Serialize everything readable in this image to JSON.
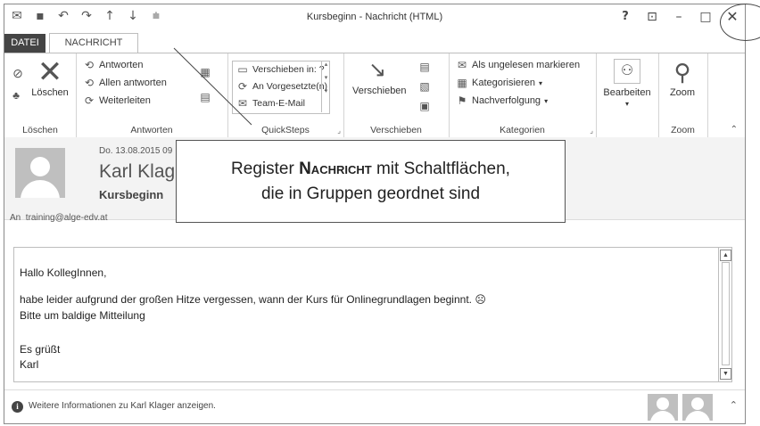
{
  "window": {
    "title": "Kursbeginn - Nachricht (HTML)",
    "qat_icons": [
      "mail-icon",
      "save-icon",
      "undo-icon",
      "redo-icon",
      "up-arrow-icon",
      "down-arrow-icon",
      "qat-customize-icon"
    ],
    "controls": {
      "help": "?",
      "ribbon_display": "⊡",
      "minimize": "–",
      "maximize": "□",
      "close": "✕"
    }
  },
  "tabs": {
    "datei": "DATEI",
    "nachricht": "NACHRICHT"
  },
  "ribbon": {
    "loeschen": {
      "label": "Löschen",
      "delete": "Löschen"
    },
    "antworten": {
      "label": "Antworten",
      "reply": "Antworten",
      "reply_all": "Allen antworten",
      "forward": "Weiterleiten"
    },
    "quicksteps": {
      "label": "QuickSteps",
      "items": [
        "Verschieben in: ?",
        "An Vorgesetzte(n)",
        "Team-E-Mail"
      ]
    },
    "verschieben": {
      "label": "Verschieben",
      "move": "Verschieben"
    },
    "kategorien": {
      "label": "Kategorien",
      "unread": "Als ungelesen markieren",
      "categorize": "Kategorisieren",
      "followup": "Nachverfolgung"
    },
    "bearbeiten": {
      "edit": "Bearbeiten"
    },
    "zoom": {
      "label": "Zoom",
      "zoom": "Zoom"
    }
  },
  "header": {
    "date": "Do. 13.08.2015 09",
    "sender": "Karl Klage",
    "subject": "Kursbeginn",
    "recipient_prefix": "An",
    "recipient": "training@alge-edv.at"
  },
  "body": {
    "greeting": "Hallo KollegInnen,",
    "line1": "habe leider aufgrund der großen Hitze vergessen, wann der Kurs für Onlinegrundlagen beginnt. ☹",
    "line2": "Bitte um baldige Mitteilung",
    "closing": "Es grüßt",
    "name": "Karl"
  },
  "footer": {
    "info": "Weitere Informationen zu Karl Klager anzeigen."
  },
  "callout": {
    "prefix": "Register ",
    "highlight": "Nachricht",
    "line1_suffix": " mit Schaltflächen,",
    "line2": "die in Gruppen geordnet sind"
  }
}
